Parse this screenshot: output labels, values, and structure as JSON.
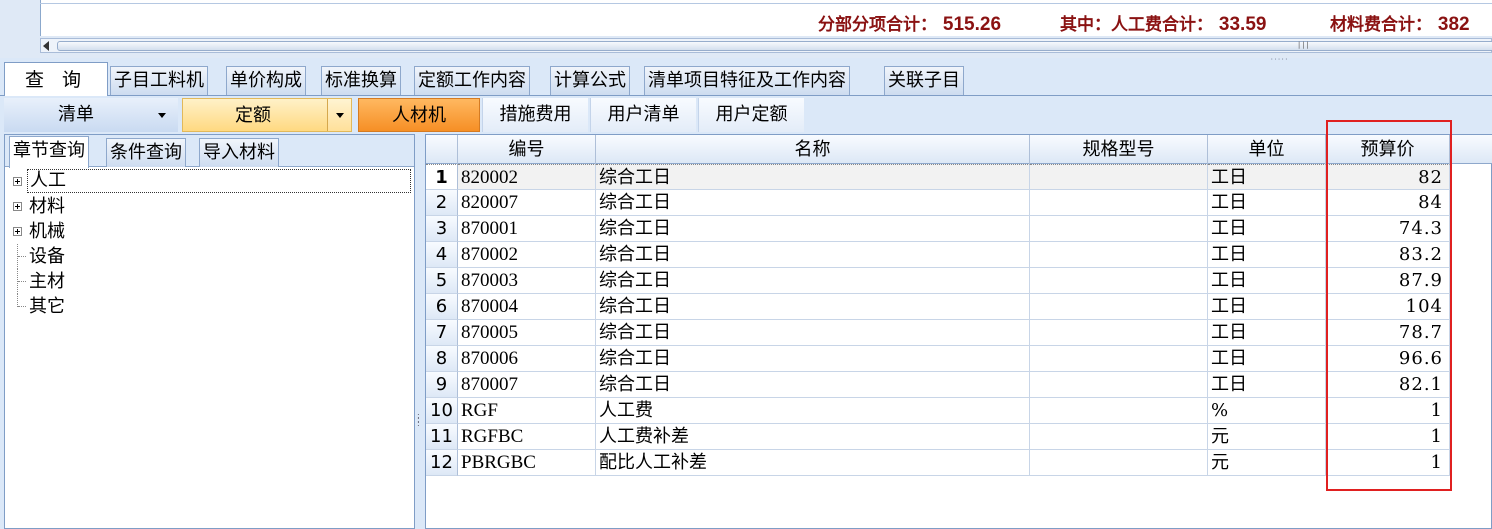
{
  "summary": {
    "subtotal_label": "分部分项合计：",
    "subtotal_value": "515.26",
    "labor_label": "其中：人工费合计：",
    "labor_value": "33.59",
    "material_label": "材料费合计：",
    "material_value": "382"
  },
  "tabs": [
    {
      "label": "查 询",
      "active": true
    },
    {
      "label": "子目工料机"
    },
    {
      "label": "单价构成"
    },
    {
      "label": "标准换算"
    },
    {
      "label": "定额工作内容"
    },
    {
      "label": "计算公式"
    },
    {
      "label": "清单项目特征及工作内容"
    },
    {
      "label": "关联子目"
    }
  ],
  "toolbar": {
    "qingdan_select": "清单",
    "dinge_select": "定额",
    "rencaiji": "人材机",
    "cuoshi": "措施费用",
    "user_qingdan": "用户清单",
    "user_dinge": "用户定额"
  },
  "left_tabs": [
    {
      "label": "章节查询",
      "active": true
    },
    {
      "label": "条件查询"
    },
    {
      "label": "导入材料"
    }
  ],
  "tree": [
    {
      "label": "人工",
      "expandable": true,
      "selected": true
    },
    {
      "label": "材料",
      "expandable": true
    },
    {
      "label": "机械",
      "expandable": true
    },
    {
      "label": "设备",
      "expandable": false
    },
    {
      "label": "主材",
      "expandable": false
    },
    {
      "label": "其它",
      "expandable": false
    }
  ],
  "grid": {
    "columns": [
      "编号",
      "名称",
      "规格型号",
      "单位",
      "预算价"
    ],
    "rows": [
      {
        "no": "1",
        "code": "820002",
        "name": "综合工日",
        "spec": "",
        "unit": "工日",
        "price": "82"
      },
      {
        "no": "2",
        "code": "820007",
        "name": "综合工日",
        "spec": "",
        "unit": "工日",
        "price": "84"
      },
      {
        "no": "3",
        "code": "870001",
        "name": "综合工日",
        "spec": "",
        "unit": "工日",
        "price": "74.3"
      },
      {
        "no": "4",
        "code": "870002",
        "name": "综合工日",
        "spec": "",
        "unit": "工日",
        "price": "83.2"
      },
      {
        "no": "5",
        "code": "870003",
        "name": "综合工日",
        "spec": "",
        "unit": "工日",
        "price": "87.9"
      },
      {
        "no": "6",
        "code": "870004",
        "name": "综合工日",
        "spec": "",
        "unit": "工日",
        "price": "104"
      },
      {
        "no": "7",
        "code": "870005",
        "name": "综合工日",
        "spec": "",
        "unit": "工日",
        "price": "78.7"
      },
      {
        "no": "8",
        "code": "870006",
        "name": "综合工日",
        "spec": "",
        "unit": "工日",
        "price": "96.6"
      },
      {
        "no": "9",
        "code": "870007",
        "name": "综合工日",
        "spec": "",
        "unit": "工日",
        "price": "82.1"
      },
      {
        "no": "10",
        "code": "RGF",
        "name": "人工费",
        "spec": "",
        "unit": "%",
        "price": "1"
      },
      {
        "no": "11",
        "code": "RGFBC",
        "name": "人工费补差",
        "spec": "",
        "unit": "元",
        "price": "1"
      },
      {
        "no": "12",
        "code": "PBRGBC",
        "name": "配比人工补差",
        "spec": "",
        "unit": "元",
        "price": "1"
      }
    ]
  },
  "colors": {
    "summary_text": "#8a1212",
    "active_toolbar": "#f68f25",
    "highlight_box": "#e02020"
  }
}
